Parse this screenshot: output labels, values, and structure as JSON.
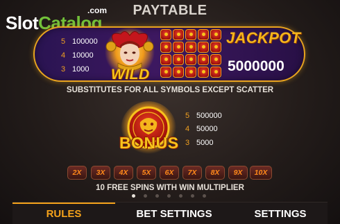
{
  "watermark": {
    "slot": "Slot",
    "catalog": "Catalog",
    "com": ".com"
  },
  "title": "PAYTABLE",
  "wild": {
    "symbol_label": "WILD",
    "pays": [
      {
        "count": "5",
        "amount": "100000"
      },
      {
        "count": "4",
        "amount": "10000"
      },
      {
        "count": "3",
        "amount": "1000"
      }
    ],
    "jackpot_label": "JACKPOT",
    "jackpot_amount": "5000000",
    "note": "SUBSTITUTES FOR ALL SYMBOLS EXCEPT SCATTER"
  },
  "bonus": {
    "symbol_label": "BONUS",
    "pays": [
      {
        "count": "5",
        "amount": "500000"
      },
      {
        "count": "4",
        "amount": "50000"
      },
      {
        "count": "3",
        "amount": "5000"
      }
    ],
    "multipliers": [
      "2X",
      "3X",
      "4X",
      "5X",
      "6X",
      "7X",
      "8X",
      "9X",
      "10X"
    ],
    "note": "10 FREE SPINS WITH WIN MULTIPLIER"
  },
  "pagination": {
    "total": 7,
    "current": 1
  },
  "tabs": [
    {
      "label": "RULES",
      "active": true
    },
    {
      "label": "BET SETTINGS",
      "active": false
    },
    {
      "label": "SETTINGS",
      "active": false
    }
  ],
  "colors": {
    "accent": "#f5a21b",
    "panel": "#3d1860",
    "jackpot": "#f5b51c",
    "multiplier": "#ff8a1a"
  }
}
